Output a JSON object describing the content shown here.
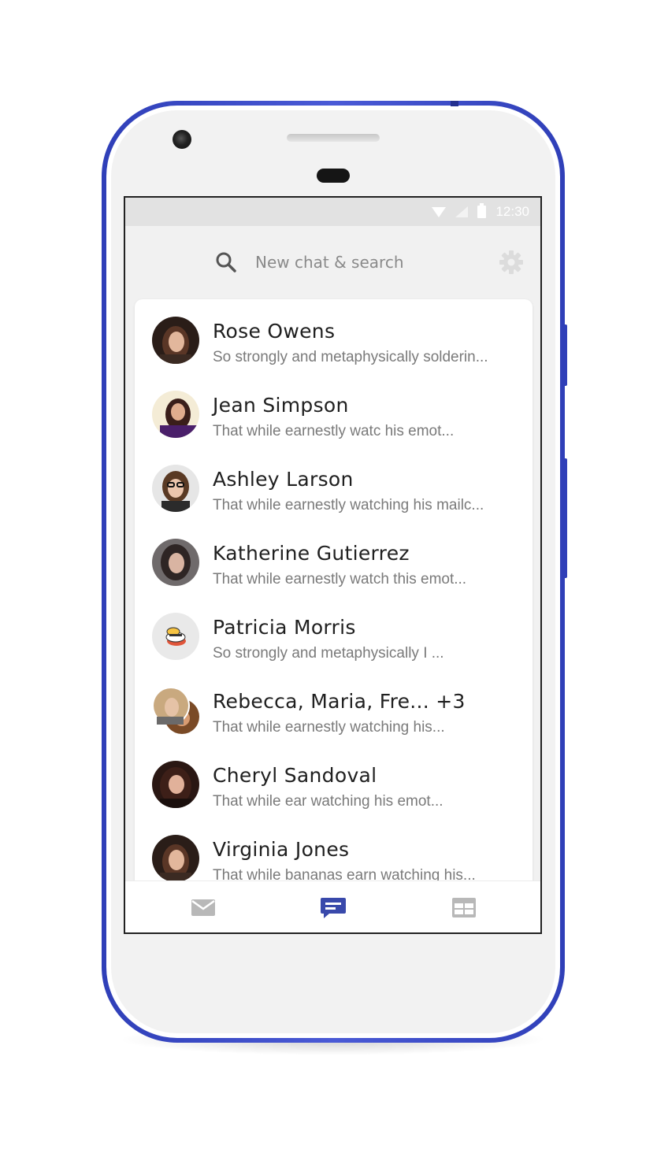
{
  "status_bar": {
    "time": "12:30"
  },
  "search": {
    "placeholder": "New chat & search"
  },
  "chats": [
    {
      "name": "Rose Owens",
      "preview": "So strongly and metaphysically solderin..."
    },
    {
      "name": "Jean Simpson",
      "preview": "That while earnestly watc his emot..."
    },
    {
      "name": "Ashley Larson",
      "preview": "That while earnestly watching his mailc..."
    },
    {
      "name": "Katherine Gutierrez",
      "preview": "That while earnestly watch this emot..."
    },
    {
      "name": "Patricia Morris",
      "preview": "So strongly and metaphysically I ..."
    },
    {
      "name": "Rebecca, Maria, Fre... +3",
      "preview": "That while earnestly watching his..."
    },
    {
      "name": "Cheryl Sandoval",
      "preview": "That while ear watching his emot..."
    },
    {
      "name": "Virginia Jones",
      "preview": "That while bananas earn watching his..."
    }
  ],
  "bottom_nav": [
    {
      "icon": "mail-icon",
      "active": false
    },
    {
      "icon": "chat-icon",
      "active": true
    },
    {
      "icon": "calendar-icon",
      "active": false
    }
  ],
  "colors": {
    "device_frame": "#3a49c9",
    "active_nav": "#3949ab",
    "inactive_nav": "#b8b8b8"
  }
}
